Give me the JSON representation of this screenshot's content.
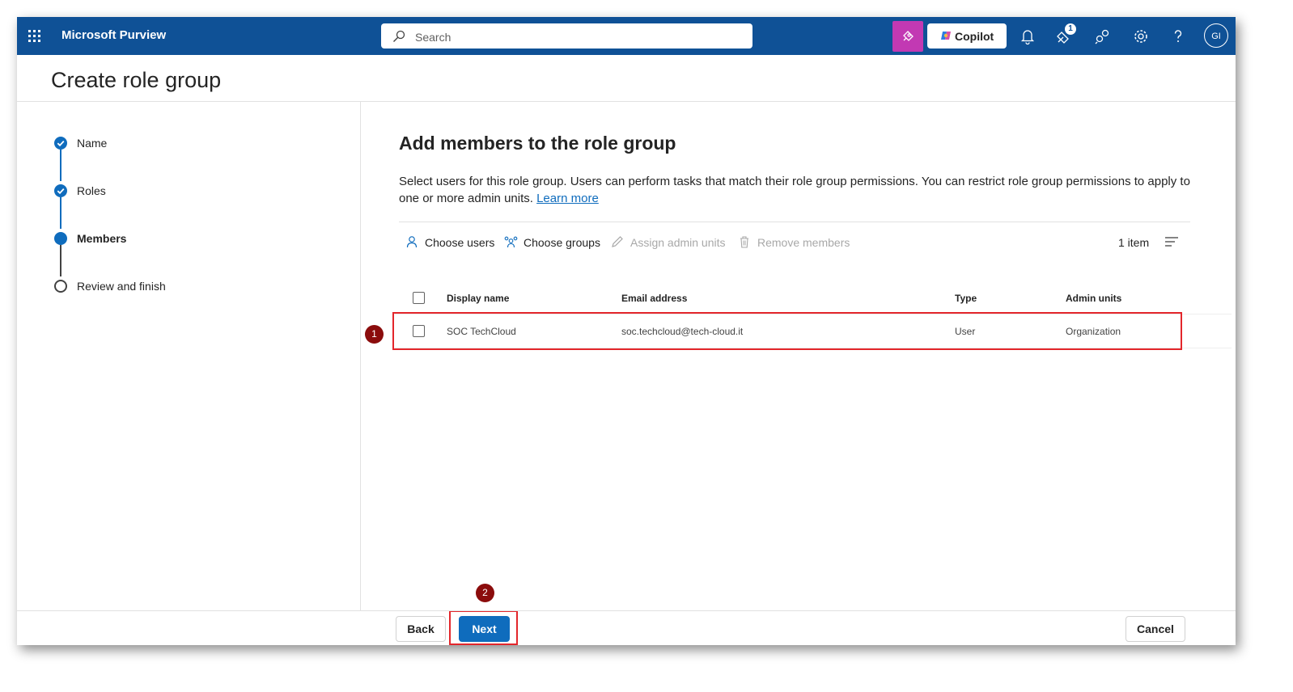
{
  "topbar": {
    "app_title": "Microsoft Purview",
    "search_placeholder": "Search",
    "copilot_label": "Copilot",
    "notification_count": "1",
    "avatar_initials": "GI",
    "brand_color": "#0f5196",
    "icons": [
      "app-launcher-icon",
      "search-icon",
      "copilot-prompt-icon",
      "bell-icon",
      "whats-new-icon",
      "share-icon",
      "gear-icon",
      "help-icon"
    ]
  },
  "page": {
    "title": "Create role group"
  },
  "stepper": {
    "steps": [
      {
        "label": "Name",
        "state": "done"
      },
      {
        "label": "Roles",
        "state": "done"
      },
      {
        "label": "Members",
        "state": "current"
      },
      {
        "label": "Review and finish",
        "state": "todo"
      }
    ]
  },
  "main": {
    "heading": "Add members to the role group",
    "description": "Select users for this role group. Users can perform tasks that match their role group permissions. You can restrict role group permissions to apply to one or more admin units.",
    "learn_more": "Learn more"
  },
  "commands": {
    "choose_users": "Choose users",
    "choose_groups": "Choose groups",
    "assign_admin_units": "Assign admin units",
    "remove_members": "Remove members",
    "item_count": "1 item"
  },
  "table": {
    "columns": [
      "Display name",
      "Email address",
      "Type",
      "Admin units"
    ],
    "rows": [
      {
        "display_name": "SOC TechCloud",
        "email": "soc.techcloud@tech-cloud.it",
        "type": "User",
        "admin_units": "Organization"
      }
    ]
  },
  "annotations": {
    "marker_1": "1",
    "marker_2": "2",
    "highlight_color": "#e3262b"
  },
  "footer": {
    "back": "Back",
    "next": "Next",
    "cancel": "Cancel"
  }
}
